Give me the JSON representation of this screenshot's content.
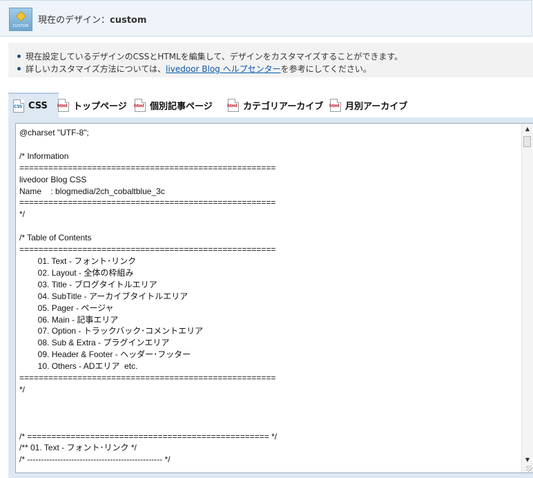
{
  "header": {
    "icon_caption": "CUSTOM",
    "label": "現在のデザイン：",
    "value": "custom"
  },
  "info": {
    "line1": "現在設定しているデザインのCSSとHTMLを編集して、デザインをカスタマイズすることができます。",
    "line2_before": "詳しいカスタマイズ方法については、",
    "line2_link": "livedoor Blog ヘルプセンター",
    "line2_after": "を参考にしてください。"
  },
  "tabs": [
    {
      "label": "CSS",
      "icon": "css-file-icon",
      "icon_text": "CSS"
    },
    {
      "label": "トップページ",
      "icon": "html-file-icon",
      "icon_text": "html"
    },
    {
      "label": "個別記事ページ",
      "icon": "html-file-icon",
      "icon_text": "html"
    },
    {
      "label": "カテゴリアーカイブ",
      "icon": "html-file-icon",
      "icon_text": "html"
    },
    {
      "label": "月別アーカイブ",
      "icon": "html-file-icon",
      "icon_text": "html"
    }
  ],
  "editor": {
    "content": "@charset \"UTF-8\";\n\n/* Information\n=====================================================\nlivedoor Blog CSS\nName    : blogmedia/2ch_cobaltblue_3c\n=====================================================\n*/\n\n/* Table of Contents\n=====================================================\n        01. Text - フォント･リンク\n        02. Layout - 全体の枠組み\n        03. Title - ブログタイトルエリア\n        04. SubTitle - アーカイブタイトルエリア\n        05. Pager - ページャ\n        06. Main - 記事エリア\n        07. Option - トラックバック･コメントエリア\n        08. Sub & Extra - プラグインエリア\n        09. Header & Footer - ヘッダー･フッター\n        10. Others - ADエリア  etc.\n=====================================================\n*/\n\n\n\n/* ================================================== */\n/** 01. Text - フォント･リンク */\n/* ------------------------------------------------- */"
  }
}
